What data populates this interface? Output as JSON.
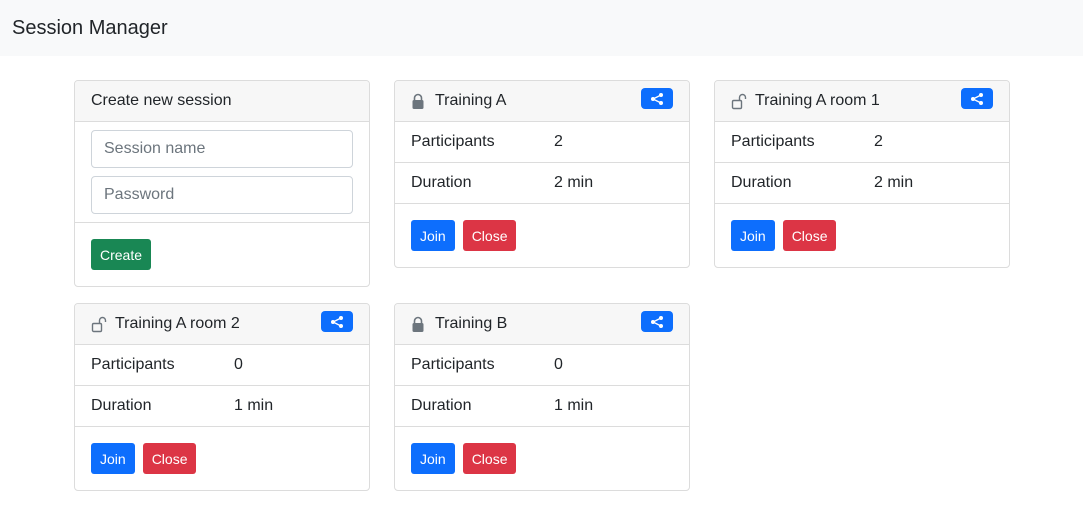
{
  "navbar": {
    "title": "Session Manager"
  },
  "create": {
    "header": "Create new session",
    "name_placeholder": "Session name",
    "password_placeholder": "Password",
    "create_label": "Create"
  },
  "labels": {
    "participants": "Participants",
    "duration": "Duration",
    "join": "Join",
    "close": "Close"
  },
  "sessions": [
    {
      "title": "Training A",
      "locked": true,
      "participants": "2",
      "duration": "2 min"
    },
    {
      "title": "Training A room 1",
      "locked": false,
      "participants": "2",
      "duration": "2 min"
    },
    {
      "title": "Training A room 2",
      "locked": false,
      "participants": "0",
      "duration": "1 min"
    },
    {
      "title": "Training B",
      "locked": true,
      "participants": "0",
      "duration": "1 min"
    }
  ],
  "icons": {
    "locked": "lock-closed-icon",
    "unlocked": "lock-open-icon",
    "share": "share-icon"
  },
  "colors": {
    "primary": "#0d6efd",
    "danger": "#dc3545",
    "success": "#198754"
  }
}
